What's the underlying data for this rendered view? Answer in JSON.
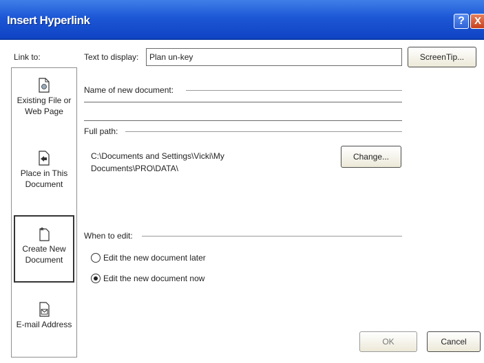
{
  "window": {
    "title": "Insert Hyperlink",
    "help_glyph": "?",
    "close_glyph": "X"
  },
  "link_to": {
    "label": "Link to:",
    "items": [
      {
        "label": "Existing File or Web Page",
        "icon": "existing-file-icon",
        "selected": false
      },
      {
        "label": "Place in This Document",
        "icon": "place-in-document-icon",
        "selected": false
      },
      {
        "label": "Create New Document",
        "icon": "create-new-document-icon",
        "selected": true
      },
      {
        "label": "E-mail Address",
        "icon": "email-address-icon",
        "selected": false
      }
    ]
  },
  "text_to_display": {
    "label": "Text to display:",
    "value": "Plan un-key"
  },
  "screentip_label": "ScreenTip...",
  "new_document": {
    "label": "Name of new document:",
    "value": ""
  },
  "full_path": {
    "label": "Full path:",
    "value_line1": "C:\\Documents and Settings\\Vicki\\My",
    "value_line2": "Documents\\PRO\\DATA\\",
    "change_label": "Change..."
  },
  "when_to_edit": {
    "label": "When to edit:",
    "options": [
      {
        "label": "Edit the new document later",
        "checked": false
      },
      {
        "label": "Edit the new document now",
        "checked": true
      }
    ]
  },
  "ok_label": "OK",
  "cancel_label": "Cancel"
}
